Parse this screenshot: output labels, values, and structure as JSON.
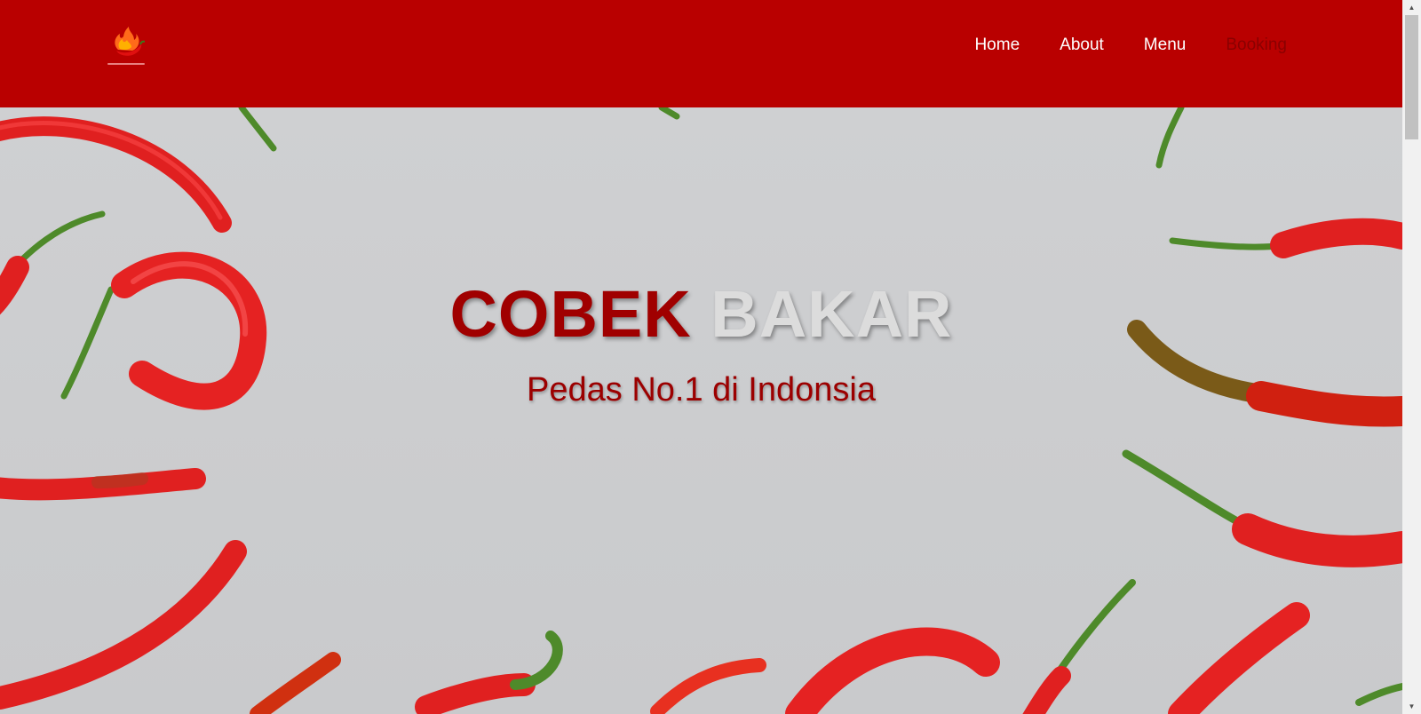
{
  "nav": {
    "logo_icon": "flame-chili-icon",
    "items": [
      {
        "label": "Home"
      },
      {
        "label": "About"
      },
      {
        "label": "Menu"
      },
      {
        "label": "Booking"
      }
    ],
    "active_item": "Booking"
  },
  "hero": {
    "title_part_1": "COBEK",
    "title_part_2": "BAKAR",
    "subtitle": "Pedas No.1 di Indonsia",
    "background": "red-chili-peppers-on-grey"
  },
  "colors": {
    "brand_red": "#b90000",
    "title_red": "#a00000",
    "active_nav": "#8a0000",
    "hero_bg": "#cfd0d2"
  }
}
